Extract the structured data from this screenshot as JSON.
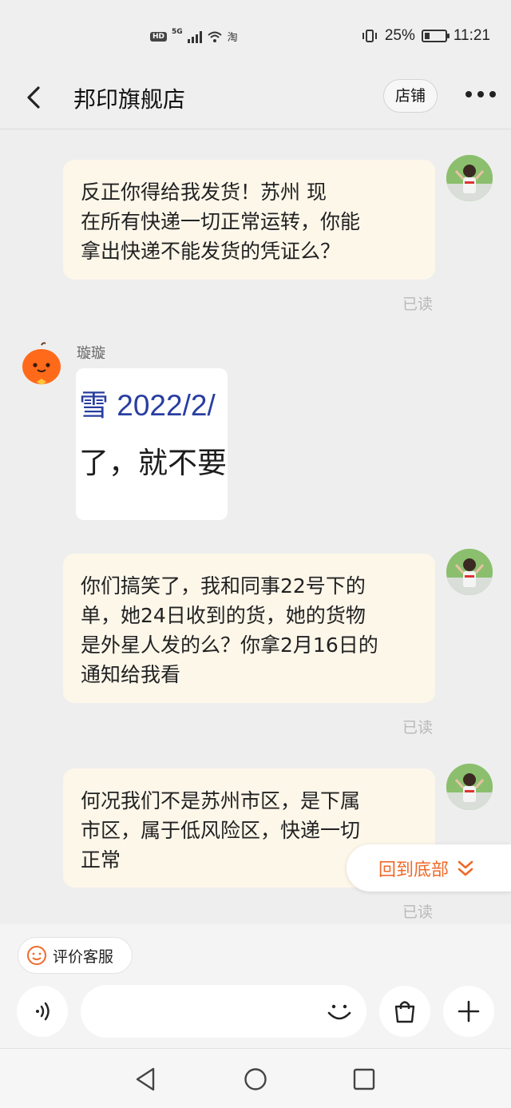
{
  "status_bar": {
    "hd": "HD",
    "net": "5G",
    "app": "淘",
    "battery": "25%",
    "battery_level": 0.25,
    "time": "11:21"
  },
  "header": {
    "title": "邦印旗舰店",
    "shop_button": "店铺"
  },
  "messages": [
    {
      "text": "反正你得给我发货！苏州 现\n在所有快递一切正常运转，你能\n拿出快递不能发货的凭证么？",
      "read": "已读"
    },
    {
      "sender": "璇璇",
      "image_line1": "雪 2022/2/",
      "image_line2": "了，就不要"
    },
    {
      "text": "你们搞笑了，我和同事22号下的\n单，她24日收到的货，她的货物\n是外星人发的么？你拿2月16日的\n通知给我看",
      "read": "已读"
    },
    {
      "text": "何况我们不是苏州市区，是下属\n市区，属于低风险区，快递一切\n正常",
      "read": "已读"
    }
  ],
  "jump_button": {
    "label": "回到底部"
  },
  "bottom": {
    "rate_label": "评价客服"
  },
  "colors": {
    "accent": "#ee6a2a",
    "bubble": "#fdf7ea",
    "read": "#b9b9b9"
  }
}
